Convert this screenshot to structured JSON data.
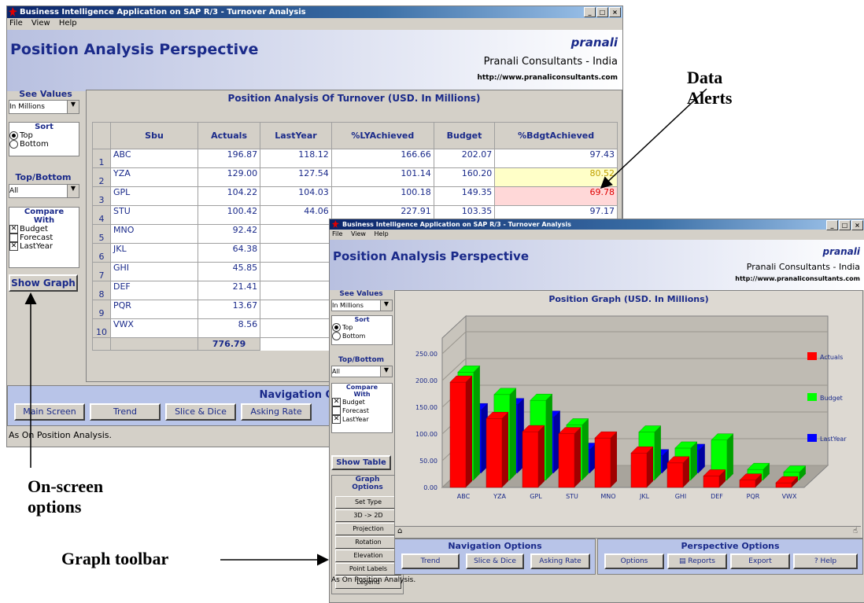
{
  "app": {
    "title": "Business Intelligence Application on SAP R/3 - Turnover Analysis",
    "menu": [
      "File",
      "View",
      "Help"
    ],
    "perspective_title": "Position Analysis Perspective",
    "logo": "pranali",
    "company": "Pranali Consultants - India",
    "url": "http://www.pranaliconsultants.com",
    "status": "As On Position Analysis."
  },
  "left_panel": {
    "see_values_label": "See Values",
    "see_values_selected": "In Millions",
    "sort_label": "Sort",
    "sort_options": [
      "Top",
      "Bottom"
    ],
    "sort_selected": "Top",
    "topbottom_label": "Top/Bottom",
    "topbottom_selected": "All",
    "compare_label": "Compare With",
    "compare_options": [
      {
        "label": "Budget",
        "checked": true
      },
      {
        "label": "Forecast",
        "checked": false
      },
      {
        "label": "LastYear",
        "checked": true
      }
    ],
    "show_graph_label": "Show Graph",
    "show_table_label": "Show Table"
  },
  "table": {
    "title": "Position Analysis Of Turnover (USD. In Millions)",
    "columns": [
      "Sbu",
      "Actuals",
      "LastYear",
      "%LYAchieved",
      "Budget",
      "%BdgtAchieved"
    ],
    "rows": [
      {
        "n": "1",
        "sbu": "ABC",
        "actuals": "196.87",
        "lastyear": "118.12",
        "ly": "166.66",
        "budget": "202.07",
        "bd": "97.43",
        "alert": ""
      },
      {
        "n": "2",
        "sbu": "YZA",
        "actuals": "129.00",
        "lastyear": "127.54",
        "ly": "101.14",
        "budget": "160.20",
        "bd": "80.52",
        "alert": "yellow"
      },
      {
        "n": "3",
        "sbu": "GPL",
        "actuals": "104.22",
        "lastyear": "104.03",
        "ly": "100.18",
        "budget": "149.35",
        "bd": "69.78",
        "alert": "red"
      },
      {
        "n": "4",
        "sbu": "STU",
        "actuals": "100.42",
        "lastyear": "44.06",
        "ly": "227.91",
        "budget": "103.35",
        "bd": "97.17",
        "alert": ""
      },
      {
        "n": "5",
        "sbu": "MNO",
        "actuals": "92.42",
        "lastyear": "",
        "ly": "",
        "budget": "",
        "bd": "",
        "alert": ""
      },
      {
        "n": "6",
        "sbu": "JKL",
        "actuals": "64.38",
        "lastyear": "",
        "ly": "",
        "budget": "",
        "bd": "",
        "alert": ""
      },
      {
        "n": "7",
        "sbu": "GHI",
        "actuals": "45.85",
        "lastyear": "",
        "ly": "",
        "budget": "",
        "bd": "",
        "alert": ""
      },
      {
        "n": "8",
        "sbu": "DEF",
        "actuals": "21.41",
        "lastyear": "",
        "ly": "",
        "budget": "",
        "bd": "",
        "alert": ""
      },
      {
        "n": "9",
        "sbu": "PQR",
        "actuals": "13.67",
        "lastyear": "",
        "ly": "",
        "budget": "",
        "bd": "",
        "alert": ""
      },
      {
        "n": "10",
        "sbu": "VWX",
        "actuals": "8.56",
        "lastyear": "",
        "ly": "",
        "budget": "",
        "bd": "",
        "alert": ""
      }
    ],
    "total": "776.79"
  },
  "nav": {
    "title": "Navigation Options",
    "buttons_w1": [
      "Main Screen",
      "Trend",
      "Slice & Dice",
      "Asking Rate"
    ],
    "buttons_w2": [
      "Trend",
      "Slice & Dice",
      "Asking Rate"
    ]
  },
  "perspective": {
    "title": "Perspective Options",
    "buttons": [
      "Options",
      "Reports",
      "Export",
      "Help"
    ]
  },
  "graph_options": {
    "title": "Graph Options",
    "buttons": [
      "Set Type",
      "3D -> 2D",
      "Projection",
      "Rotation",
      "Elevation",
      "Point Labels",
      "Legend"
    ]
  },
  "annotations": {
    "data_alerts": "Data Alerts",
    "onscreen": "On-screen options",
    "graph_toolbar": "Graph toolbar"
  },
  "colors": {
    "actuals": "#ff0000",
    "budget": "#00ff00",
    "lastyear": "#0000ff",
    "nav": "#b8c4e8",
    "title": "#1a2a8a"
  },
  "chart_data": {
    "type": "bar",
    "title": "Position Graph (USD. In Millions)",
    "categories": [
      "ABC",
      "YZA",
      "GPL",
      "STU",
      "MNO",
      "JKL",
      "GHI",
      "DEF",
      "PQR",
      "VWX"
    ],
    "series": [
      {
        "name": "Actuals",
        "values": [
          196.87,
          129.0,
          104.22,
          100.42,
          92.42,
          64.38,
          45.85,
          21.41,
          13.67,
          8.56
        ]
      },
      {
        "name": "Budget",
        "values": [
          202.07,
          160.2,
          149.35,
          103.35,
          0,
          90,
          60,
          75,
          20,
          15
        ]
      },
      {
        "name": "LastYear",
        "values": [
          118.12,
          127.54,
          104.03,
          44.06,
          0,
          32,
          42,
          0,
          0,
          0
        ]
      }
    ],
    "yticks": [
      "250.00",
      "200.00",
      "150.00",
      "100.00",
      "50.00",
      "0.00"
    ],
    "ylim": [
      0,
      250
    ],
    "legend_position": "right"
  }
}
